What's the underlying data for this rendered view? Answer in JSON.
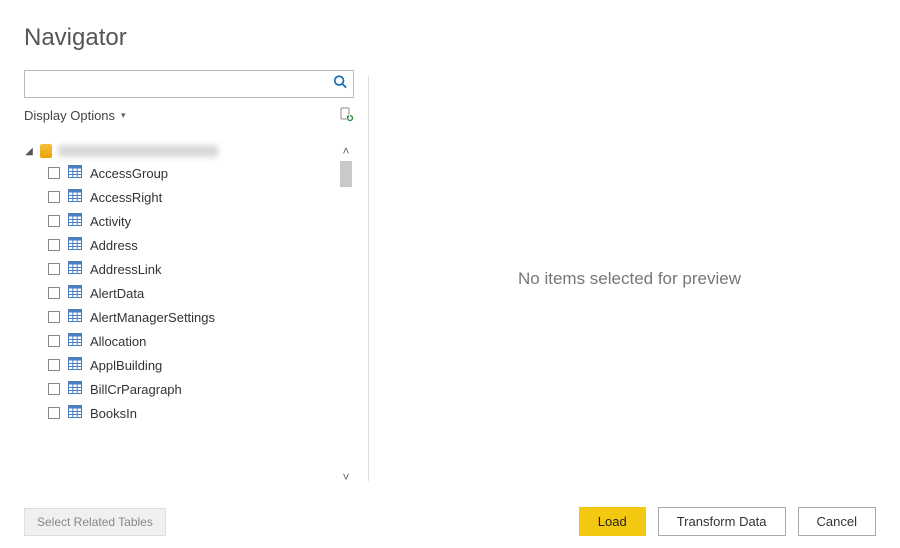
{
  "title": "Navigator",
  "search": {
    "placeholder": ""
  },
  "displayOptions": {
    "label": "Display Options"
  },
  "tree": {
    "rootLabel": "",
    "items": [
      {
        "label": "AccessGroup"
      },
      {
        "label": "AccessRight"
      },
      {
        "label": "Activity"
      },
      {
        "label": "Address"
      },
      {
        "label": "AddressLink"
      },
      {
        "label": "AlertData"
      },
      {
        "label": "AlertManagerSettings"
      },
      {
        "label": "Allocation"
      },
      {
        "label": "ApplBuilding"
      },
      {
        "label": "BillCrParagraph"
      },
      {
        "label": "BooksIn"
      }
    ]
  },
  "preview": {
    "empty": "No items selected for preview"
  },
  "footer": {
    "selectRelated": "Select Related Tables",
    "load": "Load",
    "transform": "Transform Data",
    "cancel": "Cancel"
  }
}
